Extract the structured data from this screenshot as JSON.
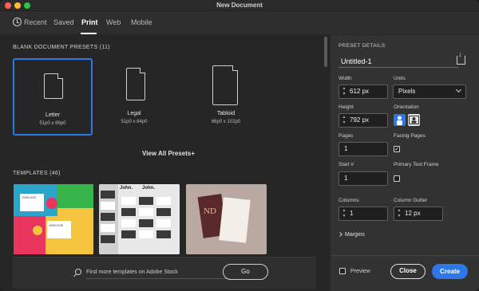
{
  "window": {
    "title": "New Document"
  },
  "nav": {
    "tabs": [
      {
        "label": "Recent",
        "icon": "clock-icon"
      },
      {
        "label": "Saved"
      },
      {
        "label": "Print",
        "active": true
      },
      {
        "label": "Web"
      },
      {
        "label": "Mobile"
      }
    ]
  },
  "presets": {
    "heading": "BLANK DOCUMENT PRESETS",
    "count": "(11)",
    "items": [
      {
        "name": "Letter",
        "size": "51p0 x 66p0",
        "selected": true
      },
      {
        "name": "Legal",
        "size": "51p0 x 84p0"
      },
      {
        "name": "Tabloid",
        "size": "66p0 x 102p0"
      }
    ],
    "view_all": "View All Presets",
    "view_all_icon": "+"
  },
  "templates": {
    "heading": "TEMPLATES",
    "count": "(46)",
    "card1_text_a": "JOHN DOE",
    "card1_text_b": "JOHN DOE",
    "card2_text": "John.",
    "card3_text": "ND"
  },
  "stock": {
    "placeholder": "Find more templates on Adobe Stock",
    "go_label": "Go"
  },
  "details": {
    "heading": "PRESET DETAILS",
    "name": "Untitled-1",
    "width_label": "Width",
    "width_value": "612 px",
    "units_label": "Units",
    "units_value": "Pixels",
    "height_label": "Height",
    "height_value": "792 px",
    "orientation_label": "Orientation",
    "pages_label": "Pages",
    "pages_value": "1",
    "facing_label": "Facing Pages",
    "facing_checked": true,
    "start_label": "Start #",
    "start_value": "1",
    "ptf_label": "Primary Text Frame",
    "ptf_checked": false,
    "columns_label": "Columns",
    "columns_value": "1",
    "gutter_label": "Column Gutter",
    "gutter_value": "12 px",
    "margins_label": "Margins",
    "preview_label": "Preview",
    "close_label": "Close",
    "create_label": "Create"
  },
  "colors": {
    "accent": "#2d78e8"
  }
}
